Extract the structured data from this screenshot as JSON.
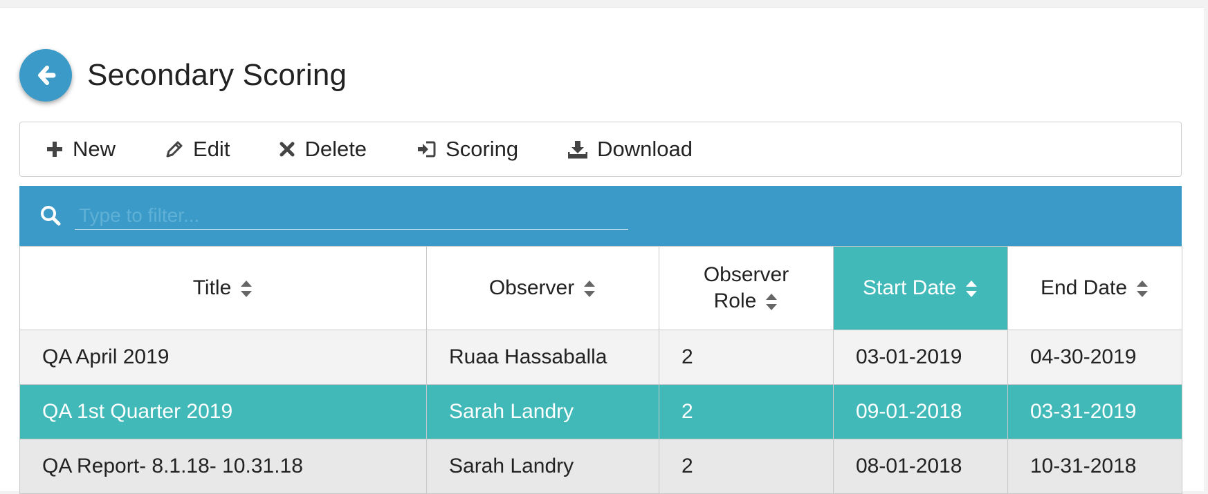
{
  "header": {
    "title": "Secondary Scoring",
    "back_icon": "arrow-left-icon"
  },
  "toolbar": {
    "new_label": "New",
    "edit_label": "Edit",
    "delete_label": "Delete",
    "scoring_label": "Scoring",
    "download_label": "Download"
  },
  "filter": {
    "placeholder": "Type to filter...",
    "value": ""
  },
  "table": {
    "columns": [
      {
        "label": "Title"
      },
      {
        "label": "Observer"
      },
      {
        "label_line1": "Observer",
        "label_line2": "Role"
      },
      {
        "label": "Start Date"
      },
      {
        "label": "End Date"
      }
    ],
    "rows": [
      {
        "title": "QA April 2019",
        "observer": "Ruaa Hassaballa",
        "role": "2",
        "start": "03-01-2019",
        "end": "04-30-2019"
      },
      {
        "title": "QA 1st Quarter 2019",
        "observer": "Sarah Landry",
        "role": "2",
        "start": "09-01-2018",
        "end": "03-31-2019"
      },
      {
        "title": "QA Report- 8.1.18- 10.31.18",
        "observer": "Sarah Landry",
        "role": "2",
        "start": "08-01-2018",
        "end": "10-31-2018"
      }
    ]
  },
  "colors": {
    "primary": "#3b9ac7",
    "accent": "#40b9b8"
  }
}
